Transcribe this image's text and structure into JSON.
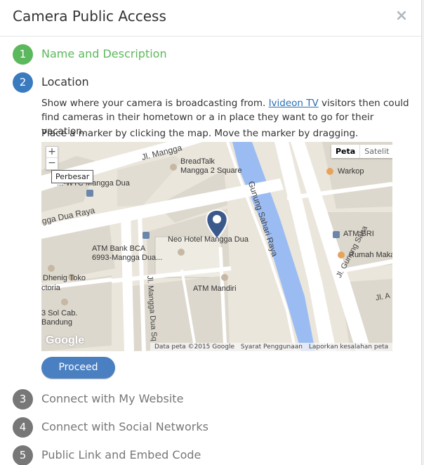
{
  "dialog": {
    "title": "Camera Public Access",
    "close": "×"
  },
  "steps": [
    {
      "num": "1",
      "label": "Name and Description"
    },
    {
      "num": "2",
      "label": "Location"
    },
    {
      "num": "3",
      "label": "Connect with My Website"
    },
    {
      "num": "4",
      "label": "Connect with Social Networks"
    },
    {
      "num": "5",
      "label": "Public Link and Embed Code"
    }
  ],
  "location": {
    "desc_before": "Show where your camera is broadcasting from. ",
    "link_text": "Ivideon TV",
    "desc_after": " visitors then could find cameras in their hometown or a in place they want to go for their vacation.",
    "hint": "Place a marker by clicking the map. Move the marker by dragging."
  },
  "map": {
    "zoom_in": "+",
    "zoom_out": "−",
    "tooltip": "Perbesar",
    "type_map": "Peta",
    "type_satellite": "Satelit",
    "footer_data": "Data peta ©2015 Google",
    "footer_terms": "Syarat Penggunaan",
    "footer_report": "Laporkan kesalahan peta",
    "logo": "Google",
    "labels": {
      "jl_mangga": "Jl. Mangga",
      "breadtalk": "BreadTalk\nMangga 2 Square",
      "bank_bca": "Bank BCA\n...-WTC Mangga Dua",
      "warkop": "Warkop",
      "mangga_dua_raya": "gga Dua Raya",
      "gunung_sahari_raya": "Gunung Sahari Raya",
      "atm_bri": "ATM BRI",
      "neo_hotel": "Neo Hotel Mangga Dua",
      "atm_bca": "ATM Bank BCA\n6993-Mangga Dua...",
      "rumah_makan": "Rumah Maka",
      "dhenig": "Dhenig Toko",
      "ctoria": "ctoria",
      "atm_mandiri": "ATM Mandiri",
      "sol_cab": "3 Sol Cab.\nBandung",
      "jl_mangga_dua_sq": "Jl. Mangga Dua Sq",
      "jl_gunung_sahari": "Jl. Gunung Saha",
      "jl_a": "Jl. A"
    },
    "colors": {
      "land": "#ebe6dc",
      "road": "#ffffff",
      "block": "#ddd8cd",
      "canal": "#9bbcf3",
      "marker": "#3a5a8c"
    }
  },
  "proceed_label": "Proceed"
}
